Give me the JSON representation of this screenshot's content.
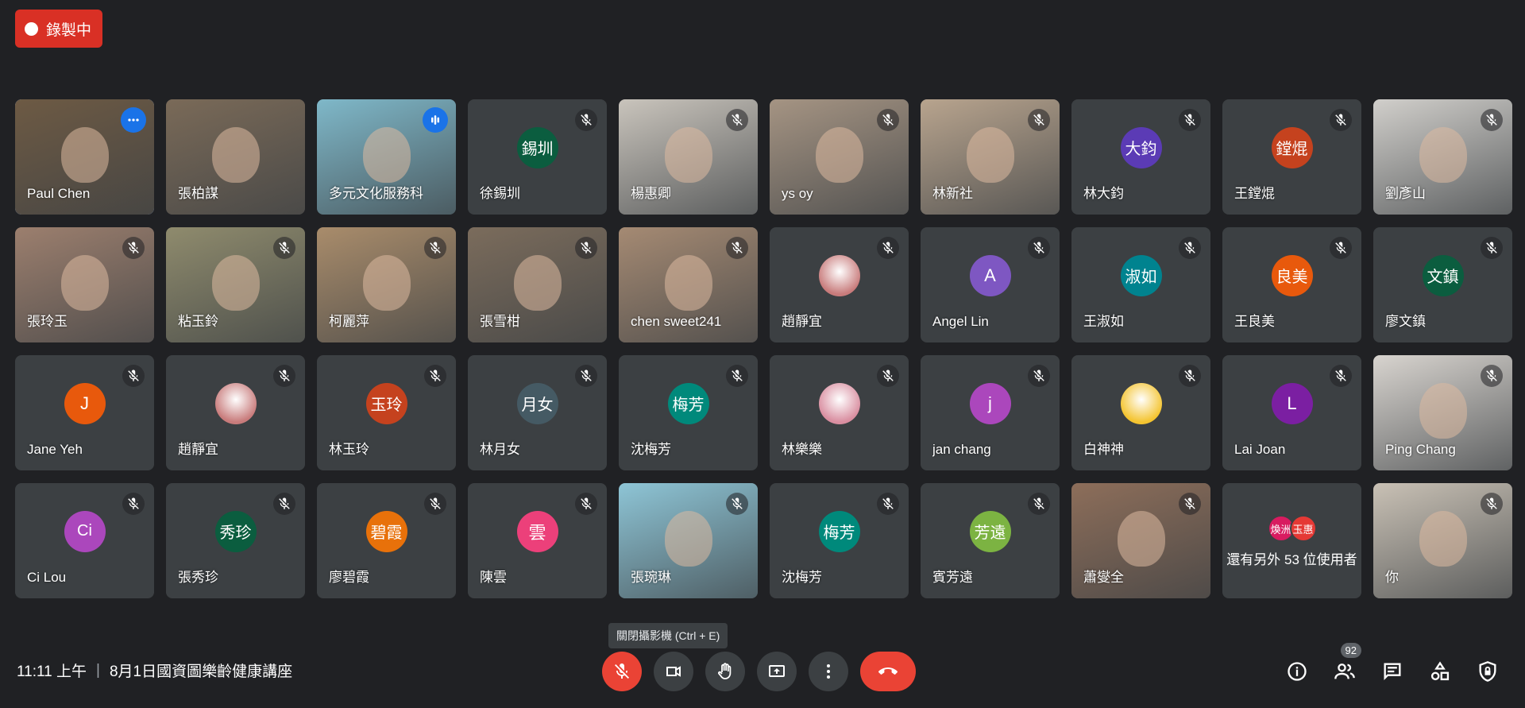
{
  "recording": {
    "label": "錄製中"
  },
  "meeting": {
    "time": "11:11 上午",
    "separator": "|",
    "title": "8月1日國資圖樂齡健康講座"
  },
  "tooltip": "關閉攝影機 (Ctrl + E)",
  "people_count": "92",
  "tiles": [
    {
      "name": "Paul Chen",
      "type": "video",
      "bg": "#6d5a44",
      "speaking": true,
      "badge": "more"
    },
    {
      "name": "張柏謀",
      "type": "video",
      "bg": "#7a6a58",
      "muted": false
    },
    {
      "name": "多元文化服務科",
      "type": "video",
      "bg": "#7fb8c9",
      "badge": "audio"
    },
    {
      "name": "徐錫圳",
      "type": "avatar",
      "initials": "錫圳",
      "color": "#0b5d3f",
      "muted": true
    },
    {
      "name": "楊惠卿",
      "type": "video",
      "bg": "#c9c4bc",
      "muted": true
    },
    {
      "name": "ys oy",
      "type": "video",
      "bg": "#a59483",
      "muted": true
    },
    {
      "name": "林新社",
      "type": "video",
      "bg": "#b8a48e",
      "muted": true
    },
    {
      "name": "林大鈞",
      "type": "avatar",
      "initials": "大鈞",
      "color": "#5b3bb5",
      "muted": true
    },
    {
      "name": "王鏜焜",
      "type": "avatar",
      "initials": "鏜焜",
      "color": "#c5421e",
      "muted": true
    },
    {
      "name": "劉彥山",
      "type": "video",
      "bg": "#d1cfcb",
      "muted": true
    },
    {
      "name": "張玲玉",
      "type": "video",
      "bg": "#9c7f6e",
      "muted": true
    },
    {
      "name": "粘玉鈴",
      "type": "video",
      "bg": "#8f8b6d",
      "muted": true
    },
    {
      "name": "柯麗萍",
      "type": "video",
      "bg": "#a98c6b",
      "muted": true
    },
    {
      "name": "張雪柑",
      "type": "video",
      "bg": "#7b6c5c",
      "muted": true
    },
    {
      "name": "chen sweet241",
      "type": "video",
      "bg": "#a58a73",
      "muted": true
    },
    {
      "name": "趙靜宜",
      "type": "photo",
      "color": "#c87b7b",
      "muted": true
    },
    {
      "name": "Angel Lin",
      "type": "avatar",
      "initials": "A",
      "color": "#7e57c2",
      "muted": true
    },
    {
      "name": "王淑如",
      "type": "avatar",
      "initials": "淑如",
      "color": "#00838f",
      "muted": true
    },
    {
      "name": "王良美",
      "type": "avatar",
      "initials": "良美",
      "color": "#e8590c",
      "muted": true
    },
    {
      "name": "廖文鎮",
      "type": "avatar",
      "initials": "文鎮",
      "color": "#0b5d3f",
      "muted": true
    },
    {
      "name": "Jane Yeh",
      "type": "avatar",
      "initials": "J",
      "color": "#e8590c",
      "muted": true
    },
    {
      "name": "趙靜宜",
      "type": "photo",
      "color": "#c87b7b",
      "muted": true
    },
    {
      "name": "林玉玲",
      "type": "avatar",
      "initials": "玉玲",
      "color": "#c5421e",
      "muted": true
    },
    {
      "name": "林月女",
      "type": "avatar",
      "initials": "月女",
      "color": "#455a64",
      "muted": true
    },
    {
      "name": "沈梅芳",
      "type": "avatar",
      "initials": "梅芳",
      "color": "#00897b",
      "muted": true
    },
    {
      "name": "林樂樂",
      "type": "photo",
      "color": "#d98ea0",
      "muted": true
    },
    {
      "name": "jan chang",
      "type": "avatar",
      "initials": "j",
      "color": "#ab47bc",
      "muted": true
    },
    {
      "name": "白神神",
      "type": "photo",
      "color": "#f4c430",
      "muted": true
    },
    {
      "name": "Lai Joan",
      "type": "avatar",
      "initials": "L",
      "color": "#7b1fa2",
      "muted": true
    },
    {
      "name": "Ping Chang",
      "type": "video",
      "bg": "#d8d4cf",
      "muted": true
    },
    {
      "name": "Ci Lou",
      "type": "avatar",
      "initials": "Ci",
      "color": "#ab47bc",
      "muted": true
    },
    {
      "name": "張秀珍",
      "type": "avatar",
      "initials": "秀珍",
      "color": "#0b5d3f",
      "muted": true
    },
    {
      "name": "廖碧霞",
      "type": "avatar",
      "initials": "碧霞",
      "color": "#e8710a",
      "muted": true
    },
    {
      "name": "陳雲",
      "type": "avatar",
      "initials": "雲",
      "color": "#ec407a",
      "muted": true
    },
    {
      "name": "張琬琳",
      "type": "video",
      "bg": "#8ec5d6",
      "muted": true
    },
    {
      "name": "沈梅芳",
      "type": "avatar",
      "initials": "梅芳",
      "color": "#00897b",
      "muted": true
    },
    {
      "name": "賓芳遠",
      "type": "avatar",
      "initials": "芳遠",
      "color": "#7cb342",
      "muted": true
    },
    {
      "name": "蕭燮全",
      "type": "video",
      "bg": "#8d6e5a",
      "muted": true
    },
    {
      "name": "還有另外 53 位使用者",
      "type": "more",
      "mini": [
        "煥洲",
        "玉惠"
      ],
      "mini_colors": [
        "#d81b60",
        "#e53935"
      ]
    },
    {
      "name": "你",
      "type": "video",
      "bg": "#c9c1b5",
      "muted": true
    }
  ]
}
